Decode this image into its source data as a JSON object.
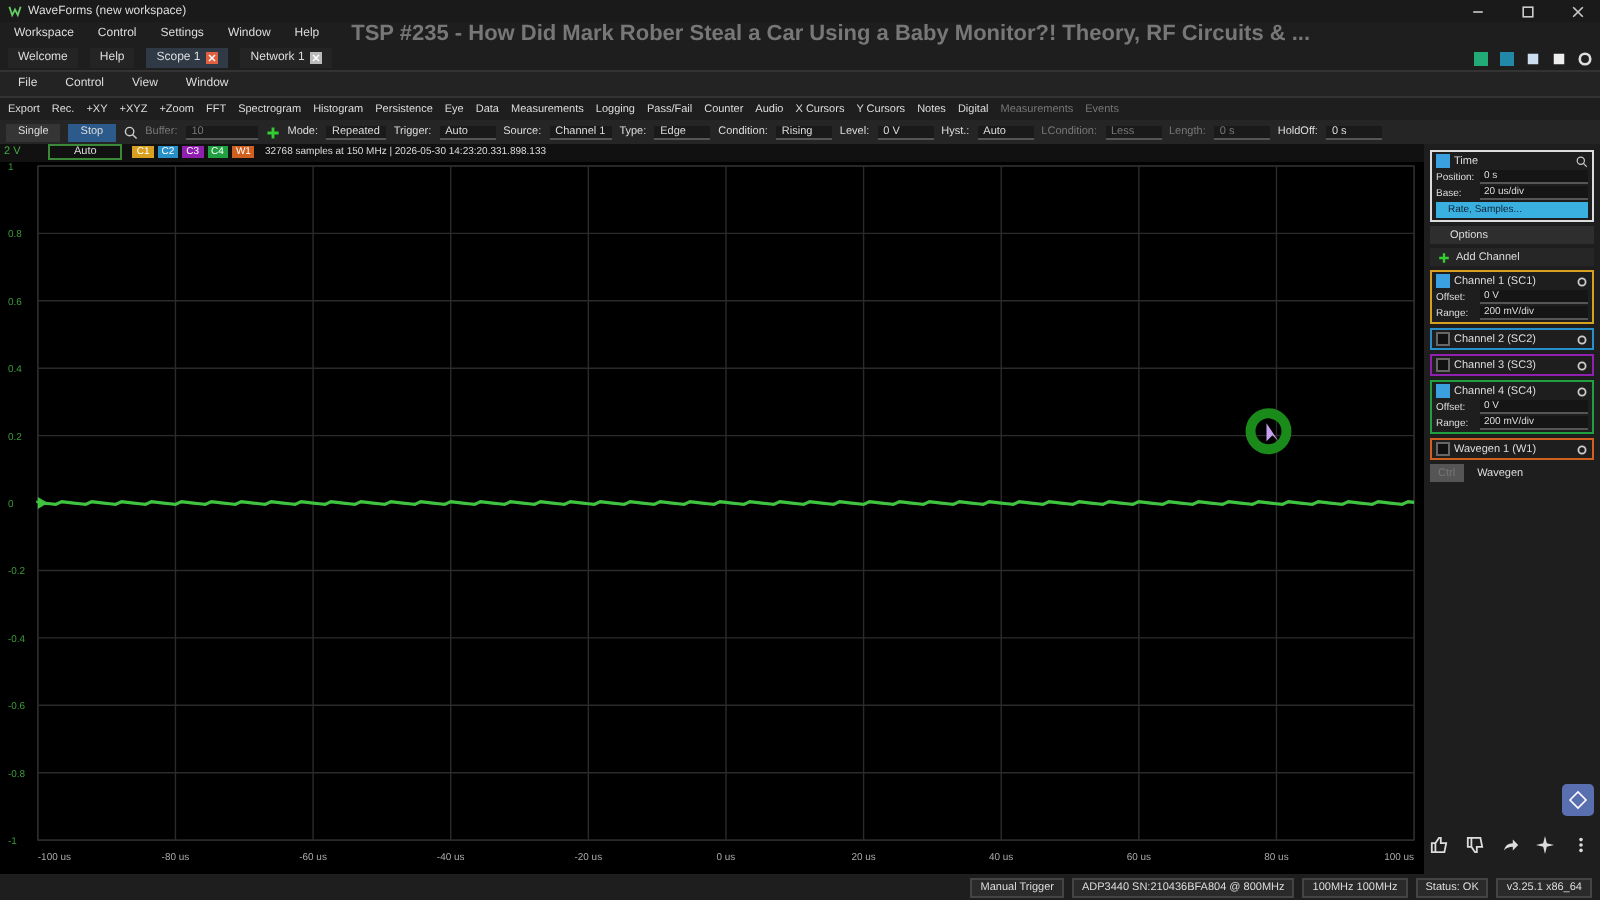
{
  "window": {
    "title": "WaveForms (new workspace)"
  },
  "video_title": "TSP #235 - How Did Mark Rober Steal a Car Using a Baby Monitor?! Theory, RF Circuits & ...",
  "main_menu": [
    "Workspace",
    "Control",
    "Settings",
    "Window",
    "Help"
  ],
  "tabs": [
    {
      "label": "Welcome",
      "selected": false,
      "closable": false
    },
    {
      "label": "Help",
      "selected": false,
      "closable": false
    },
    {
      "label": "Scope 1",
      "selected": true,
      "closable": true
    },
    {
      "label": "Network 1",
      "selected": false,
      "closable": true
    }
  ],
  "scope_menu": [
    "File",
    "Control",
    "View",
    "Window"
  ],
  "toolbar": [
    {
      "label": "Export",
      "disabled": false
    },
    {
      "label": "Rec.",
      "disabled": false
    },
    {
      "label": "+XY",
      "disabled": false
    },
    {
      "label": "+XYZ",
      "disabled": false
    },
    {
      "label": "+Zoom",
      "disabled": false
    },
    {
      "label": "FFT",
      "disabled": false
    },
    {
      "label": "Spectrogram",
      "disabled": false
    },
    {
      "label": "Histogram",
      "disabled": false
    },
    {
      "label": "Persistence",
      "disabled": false
    },
    {
      "label": "Eye",
      "disabled": false
    },
    {
      "label": "Data",
      "disabled": false
    },
    {
      "label": "Measurements",
      "disabled": false
    },
    {
      "label": "Logging",
      "disabled": false
    },
    {
      "label": "Pass/Fail",
      "disabled": false
    },
    {
      "label": "Counter",
      "disabled": false
    },
    {
      "label": "Audio",
      "disabled": false
    },
    {
      "label": "X Cursors",
      "disabled": false
    },
    {
      "label": "Y Cursors",
      "disabled": false
    },
    {
      "label": "Notes",
      "disabled": false
    },
    {
      "label": "Digital",
      "disabled": false
    },
    {
      "label": "Measurements",
      "disabled": true
    },
    {
      "label": "Events",
      "disabled": true
    }
  ],
  "acquire": {
    "single": "Single",
    "stop": "Stop",
    "buffer_label": "Buffer:",
    "buffer": "10"
  },
  "trigger_fields": [
    {
      "label": "Mode:",
      "value": "Repeated",
      "disabled": false
    },
    {
      "label": "Trigger:",
      "value": "Auto",
      "disabled": false
    },
    {
      "label": "Source:",
      "value": "Channel 1",
      "disabled": false
    },
    {
      "label": "Type:",
      "value": "Edge",
      "disabled": false
    },
    {
      "label": "Condition:",
      "value": "Rising",
      "disabled": false
    },
    {
      "label": "Level:",
      "value": "0 V",
      "disabled": false
    },
    {
      "label": "Hyst.:",
      "value": "Auto",
      "disabled": false
    },
    {
      "label": "LCondition:",
      "value": "Less",
      "disabled": true
    },
    {
      "label": "Length:",
      "value": "0 s",
      "disabled": true
    },
    {
      "label": "HoldOff:",
      "value": "0 s",
      "disabled": false
    }
  ],
  "info_bar": {
    "unit": "2 V",
    "mode": "Auto",
    "channel_tags": [
      {
        "label": "C1",
        "color": "#d8a020"
      },
      {
        "label": "C2",
        "color": "#2890c8"
      },
      {
        "label": "C3",
        "color": "#9020b0"
      },
      {
        "label": "C4",
        "color": "#20a040"
      },
      {
        "label": "W1",
        "color": "#d06020"
      }
    ],
    "status": "32768 samples at 150 MHz | 2026-05-30 14:23:20.331.898.133"
  },
  "plot": {
    "yticks": [
      "1",
      "0.8",
      "0.6",
      "0.4",
      "0.2",
      "0",
      "-0.2",
      "-0.4",
      "-0.6",
      "-0.8",
      "-1"
    ],
    "xticks": [
      "-100 us",
      "-80 us",
      "-60 us",
      "-40 us",
      "-20 us",
      "0 us",
      "20 us",
      "40 us",
      "60 us",
      "80 us",
      "100 us"
    ]
  },
  "time_panel": {
    "title": "Time",
    "checked": true,
    "fields": [
      {
        "label": "Position:",
        "value": "0 s"
      },
      {
        "label": "Base:",
        "value": "20 us/div"
      }
    ],
    "button": "Rate, Samples..."
  },
  "options": "Options",
  "add_channel": "Add Channel",
  "channels": [
    {
      "name": "Channel 1 (SC1)",
      "color": "#d8a020",
      "checked": true,
      "expanded": true,
      "offset_label": "Offset:",
      "offset": "0 V",
      "range_label": "Range:",
      "range": "200 mV/div"
    },
    {
      "name": "Channel 2 (SC2)",
      "color": "#2890c8",
      "checked": false,
      "expanded": false
    },
    {
      "name": "Channel 3 (SC3)",
      "color": "#9020b0",
      "checked": false,
      "expanded": false
    },
    {
      "name": "Channel 4 (SC4)",
      "color": "#20a040",
      "checked": true,
      "expanded": true,
      "offset_label": "Offset:",
      "offset": "0 V",
      "range_label": "Range:",
      "range": "200 mV/div"
    },
    {
      "name": "Wavegen 1 (W1)",
      "color": "#d06020",
      "checked": false,
      "expanded": false
    }
  ],
  "panel_buttons": [
    {
      "label": "Ctrl",
      "disabled": true
    },
    {
      "label": "Wavegen",
      "disabled": false
    }
  ],
  "status_bar": [
    "Manual Trigger",
    "ADP3440 SN:210436BFA804 @ 800MHz",
    "100MHz 100MHz",
    "Status: OK",
    "v3.25.1 x86_64"
  ]
}
